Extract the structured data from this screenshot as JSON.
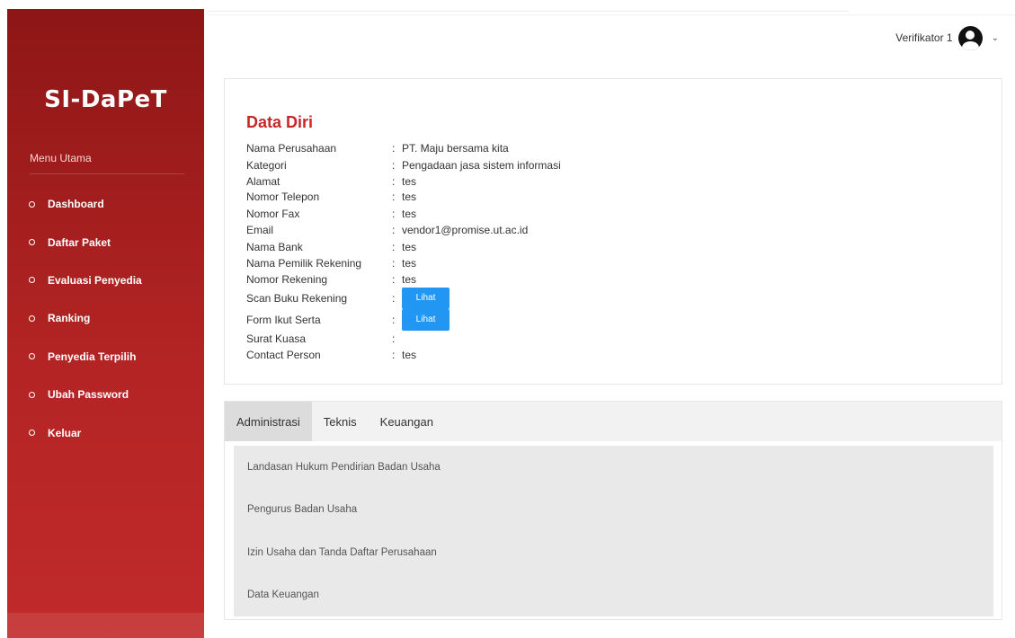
{
  "sidebar": {
    "brand": "SI-DaPeT",
    "menu_heading": "Menu Utama",
    "items": [
      {
        "label": "Dashboard"
      },
      {
        "label": "Daftar Paket"
      },
      {
        "label": "Evaluasi Penyedia"
      },
      {
        "label": "Ranking"
      },
      {
        "label": "Penyedia Terpilih"
      },
      {
        "label": "Ubah Password"
      },
      {
        "label": "Keluar"
      }
    ]
  },
  "header": {
    "user_name": "Verifikator 1",
    "avatar_icon": "user-circle-icon",
    "dropdown_icon": "chevron-down-icon"
  },
  "data_diri": {
    "title": "Data Diri",
    "separator": ":",
    "button_label": "Lihat",
    "rows": {
      "nama_perusahaan": {
        "label": "Nama Perusahaan",
        "value": "PT. Maju bersama kita"
      },
      "kategori": {
        "label": "Kategori",
        "value": "Pengadaan jasa sistem informasi"
      },
      "alamat": {
        "label": "Alamat",
        "value": "tes"
      },
      "nomor_telepon": {
        "label": "Nomor Telepon",
        "value": "tes"
      },
      "nomor_fax": {
        "label": "Nomor Fax",
        "value": "tes"
      },
      "email": {
        "label": "Email",
        "value": "vendor1@promise.ut.ac.id"
      },
      "nama_bank": {
        "label": "Nama Bank",
        "value": "tes"
      },
      "nama_pemilik_rekening": {
        "label": "Nama Pemilik Rekening",
        "value": "tes"
      },
      "nomor_rekening": {
        "label": "Nomor Rekening",
        "value": "tes"
      },
      "scan_buku_rekening": {
        "label": "Scan Buku Rekening"
      },
      "form_ikut_serta": {
        "label": "Form Ikut Serta"
      },
      "surat_kuasa": {
        "label": "Surat Kuasa",
        "value": ""
      },
      "contact_person": {
        "label": "Contact Person",
        "value": "tes"
      }
    }
  },
  "tabs": {
    "items": [
      {
        "label": "Administrasi",
        "active": true
      },
      {
        "label": "Teknis",
        "active": false
      },
      {
        "label": "Keuangan",
        "active": false
      }
    ],
    "documents": [
      {
        "label": "Landasan Hukum Pendirian Badan Usaha"
      },
      {
        "label": "Pengurus Badan Usaha"
      },
      {
        "label": "Izin Usaha dan Tanda Daftar Perusahaan"
      },
      {
        "label": "Data Keuangan"
      }
    ]
  },
  "colors": {
    "sidebar_top": "#8e1616",
    "sidebar_bottom": "#c12a2a",
    "title_red": "#c62828",
    "button_blue": "#2196f3"
  }
}
